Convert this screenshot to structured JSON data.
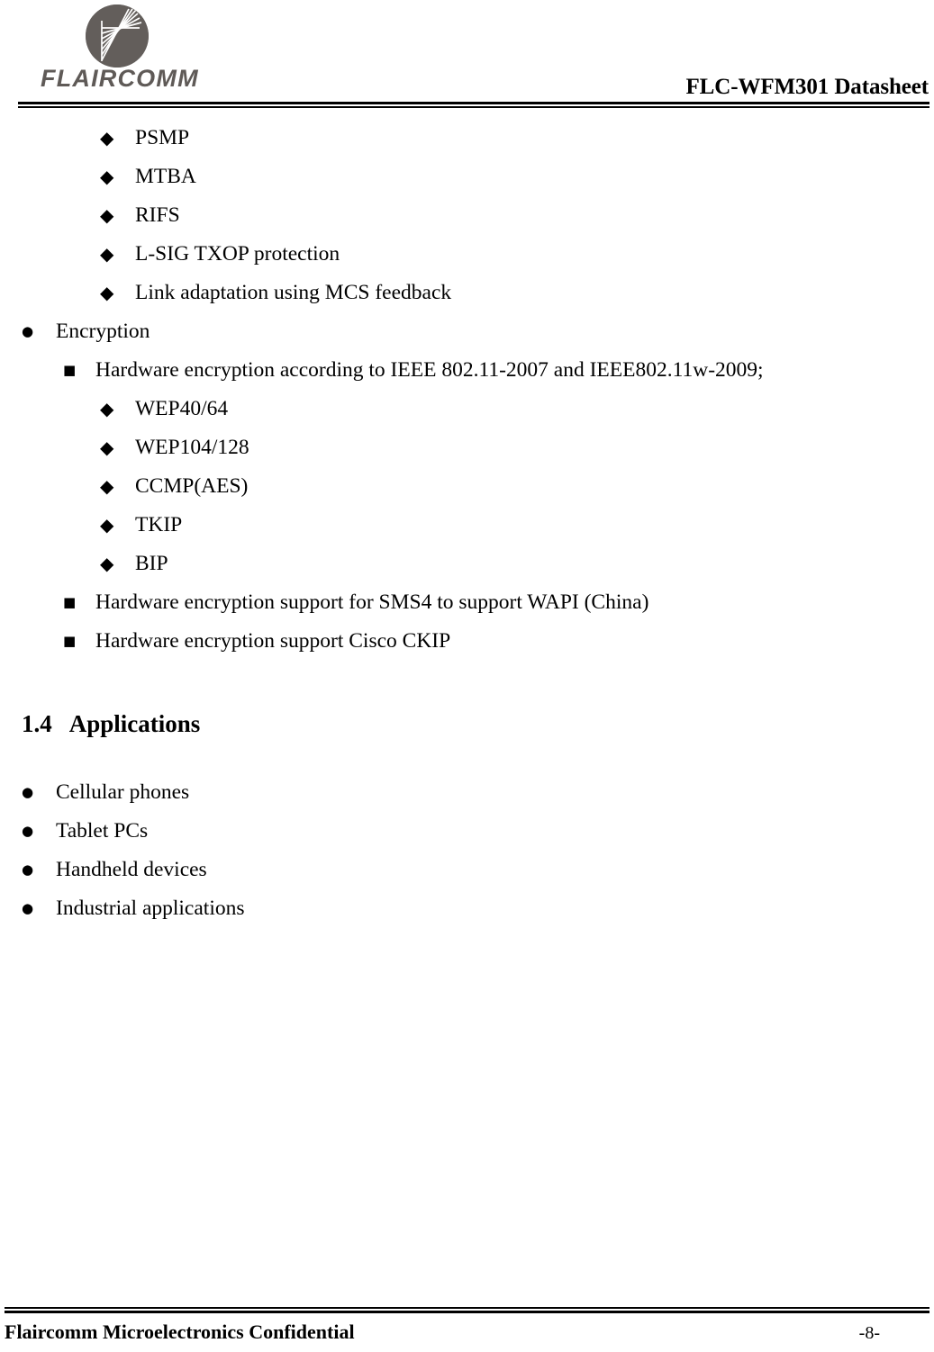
{
  "header": {
    "logo_text": "FLAIRCOMM",
    "logo_icon": "flaircomm-circle-stripes-logo",
    "title": "FLC-WFM301 Datasheet",
    "logo_color": "#635e5b"
  },
  "markers": {
    "level1": "●",
    "level2": "■",
    "level3": "◆"
  },
  "content": {
    "ht_features": [
      "PSMP",
      "MTBA",
      "RIFS",
      "L-SIG TXOP protection",
      "Link adaptation using MCS feedback"
    ],
    "encryption_heading": "Encryption",
    "encryption_hardware_line": "Hardware encryption according to IEEE 802.11-2007 and IEEE802.11w-2009;",
    "encryption_ciphers": [
      "WEP40/64",
      "WEP104/128",
      "CCMP(AES)",
      "TKIP",
      "BIP"
    ],
    "encryption_extra": [
      "Hardware encryption support for SMS4 to support WAPI (China)",
      "Hardware encryption support Cisco CKIP"
    ],
    "section": {
      "number": "1.4",
      "title": "Applications"
    },
    "applications": [
      "Cellular phones",
      "Tablet PCs",
      "Handheld devices",
      "Industrial applications"
    ]
  },
  "footer": {
    "left": "Flaircomm Microelectronics Confidential",
    "page": "-8-"
  }
}
